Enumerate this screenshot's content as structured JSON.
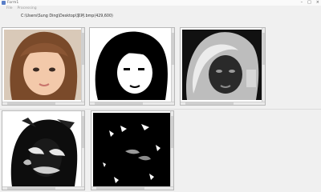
{
  "window": {
    "title": "Form1",
    "minimize": "–",
    "maximize": "□",
    "close": "×"
  },
  "menu": {
    "items": [
      "File",
      "Processing"
    ]
  },
  "path": {
    "text": "C:\\Users\\Sung Ding\\Desktop\\李珂.bmp(429,600)"
  },
  "panels": [
    {
      "name": "original-image"
    },
    {
      "name": "binary-image"
    },
    {
      "name": "gray-contrast-image"
    },
    {
      "name": "edge-image"
    },
    {
      "name": "dark-threshold-image"
    }
  ],
  "colors": {
    "panel_border": "#b8b8b8",
    "window_bg": "#f0f0f0",
    "icon": "#5a7fc8"
  }
}
